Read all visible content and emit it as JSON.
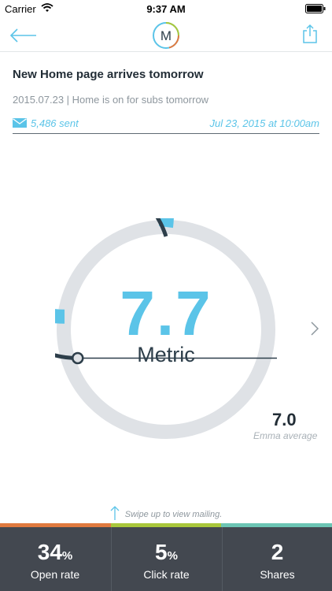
{
  "status_bar": {
    "carrier": "Carrier",
    "time": "9:37 AM"
  },
  "nav": {
    "logo_letter": "M"
  },
  "mailing": {
    "title": "New Home page arrives tomorrow",
    "subtitle": "2015.07.23 | Home is on for subs tomorrow",
    "sent": "5,486 sent",
    "date": "Jul 23, 2015 at 10:00am"
  },
  "gauge": {
    "score": "7.7",
    "label": "Metric",
    "score_value": 7.7,
    "average_value": 7.0,
    "max_value": 10,
    "colors": {
      "score": "#5bc4e8",
      "track": "#dfe2e6",
      "average": "#2d3e4a"
    }
  },
  "average": {
    "value": "7.0",
    "label": "Emma average"
  },
  "swipe_hint": "Swipe up to view mailing.",
  "stats": [
    {
      "value": "34",
      "unit": "%",
      "label": "Open rate",
      "accent": "#e07a3f"
    },
    {
      "value": "5",
      "unit": "%",
      "label": "Click rate",
      "accent": "#a9c73b"
    },
    {
      "value": "2",
      "unit": "",
      "label": "Shares",
      "accent": "#6cc5b4"
    }
  ],
  "icons": [
    "wifi-icon",
    "battery-icon",
    "back-arrow-icon",
    "logo-icon",
    "share-icon",
    "envelope-icon",
    "chevron-right-icon",
    "up-arrow-icon"
  ]
}
